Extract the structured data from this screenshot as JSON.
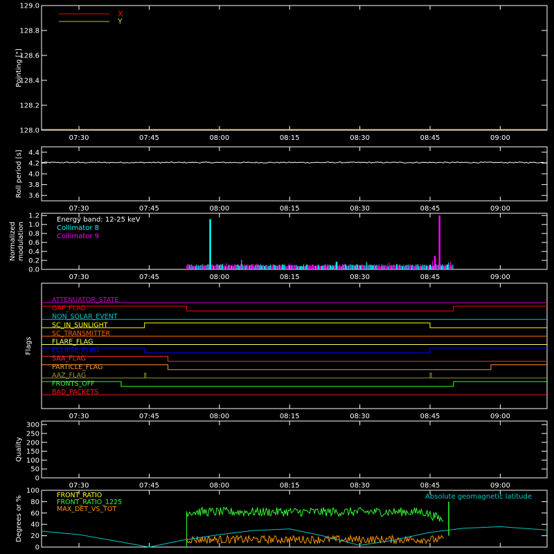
{
  "figure": {
    "background": "#000000",
    "foreground": "#ffffff"
  },
  "time_axis": {
    "start": "07:22",
    "end": "09:10",
    "ticks": [
      "07:30",
      "07:45",
      "08:00",
      "08:15",
      "08:30",
      "08:45",
      "09:00"
    ]
  },
  "chart_data": [
    {
      "type": "line",
      "ylabel": "Pointing [\"]",
      "ylim": [
        128.0,
        129.0
      ],
      "yticks": [
        "128.0",
        "128.2",
        "128.4",
        "128.6",
        "128.8",
        "129.0"
      ],
      "legend_position": "top-left",
      "series": [
        {
          "name": "X",
          "color": "#ff0000",
          "values": []
        },
        {
          "name": "Y",
          "color": "#c8c800",
          "values": []
        }
      ]
    },
    {
      "type": "line",
      "ylabel": "Roll period [s]",
      "ylim": [
        3.5,
        4.5
      ],
      "yticks": [
        "3.6",
        "3.8",
        "4.0",
        "4.2",
        "4.4"
      ],
      "series": [
        {
          "color": "#ffffff",
          "x": [
            "07:22",
            "09:10"
          ],
          "values": [
            4.21,
            4.21
          ]
        }
      ]
    },
    {
      "type": "bar",
      "ylabel": "Normalized modulation",
      "ylim": [
        0.0,
        1.25
      ],
      "yticks": [
        "0.0",
        "0.2",
        "0.4",
        "0.6",
        "0.8",
        "1.0",
        "1.2"
      ],
      "annotation": "Energy band: 12-25 keV",
      "data_range": [
        "07:53",
        "08:50"
      ],
      "baseline": 0.07,
      "series": [
        {
          "name": "Collimator 8",
          "color": "#00ffff",
          "peaks": [
            {
              "x": "07:58",
              "y": 1.12
            },
            {
              "x": "08:25",
              "y": 0.17
            }
          ]
        },
        {
          "name": "Collimator 9",
          "color": "#ff00ff",
          "peaks": [
            {
              "x": "08:47",
              "y": 1.2
            },
            {
              "x": "08:46",
              "y": 0.3
            }
          ]
        }
      ]
    },
    {
      "type": "line",
      "ylabel": "Flags",
      "series": [
        {
          "name": "ATTENUATOR_STATE",
          "color": "#c800c8",
          "steps": [
            {
              "x": "07:22",
              "v": 0
            }
          ]
        },
        {
          "name": "GAP_FLAG",
          "color": "#ff0000",
          "steps": [
            {
              "x": "07:22",
              "v": 1
            },
            {
              "x": "07:53",
              "v": 0
            },
            {
              "x": "08:50",
              "v": 1
            }
          ]
        },
        {
          "name": "NON_SOLAR_EVENT",
          "color": "#00c8c8",
          "steps": [
            {
              "x": "07:22",
              "v": 0
            }
          ]
        },
        {
          "name": "SC_IN_SUNLIGHT",
          "color": "#ffff00",
          "steps": [
            {
              "x": "07:22",
              "v": 0
            },
            {
              "x": "07:44",
              "v": 1
            },
            {
              "x": "08:45",
              "v": 0
            }
          ]
        },
        {
          "name": "SC_TRANSMITTER",
          "color": "#ff6400",
          "steps": [
            {
              "x": "07:22",
              "v": 0
            }
          ]
        },
        {
          "name": "FLARE_FLAG",
          "color": "#ffff64",
          "steps": [
            {
              "x": "07:22",
              "v": 0
            }
          ]
        },
        {
          "name": "ECLIPSE_FLAG",
          "color": "#0000ff",
          "steps": [
            {
              "x": "07:22",
              "v": 1
            },
            {
              "x": "07:44",
              "v": 0
            },
            {
              "x": "08:45",
              "v": 1
            }
          ]
        },
        {
          "name": "SAA_FLAG",
          "color": "#ff3232",
          "steps": [
            {
              "x": "07:22",
              "v": 1
            },
            {
              "x": "07:49",
              "v": 0
            }
          ]
        },
        {
          "name": "PARTICLE_FLAG",
          "color": "#ff9632",
          "steps": [
            {
              "x": "07:22",
              "v": 1
            },
            {
              "x": "07:49",
              "v": 0
            },
            {
              "x": "08:58",
              "v": 1
            }
          ]
        },
        {
          "name": "AAZ_FLAG",
          "color": "#969632",
          "steps": [
            {
              "x": "07:22",
              "v": 0
            }
          ],
          "spikes": [
            "07:44",
            "08:45"
          ]
        },
        {
          "name": "FRONTS_OFF",
          "color": "#32ff32",
          "steps": [
            {
              "x": "07:22",
              "v": 1
            },
            {
              "x": "07:39",
              "v": 0
            },
            {
              "x": "08:50",
              "v": 1
            }
          ]
        },
        {
          "name": "BAD_PACKETS",
          "color": "#ff1414",
          "steps": [
            {
              "x": "07:22",
              "v": 0
            }
          ]
        }
      ]
    },
    {
      "type": "line",
      "ylabel": "Quality",
      "ylim": [
        0,
        320
      ],
      "yticks": [
        "0",
        "50",
        "100",
        "150",
        "200",
        "250",
        "300"
      ],
      "series": []
    },
    {
      "type": "line",
      "ylabel": "Degrees or %",
      "ylim": [
        0,
        100
      ],
      "yticks": [
        "0",
        "20",
        "40",
        "60",
        "80",
        "100"
      ],
      "right_annotation": "Absolute geomagnetic latitude",
      "series": [
        {
          "name": "FRONT_RATIO",
          "color": "#ffff00",
          "values": []
        },
        {
          "name": "FRONT_RATIO_1225",
          "color": "#32ff32",
          "data_range": [
            "07:53",
            "08:48"
          ],
          "level": 62,
          "spike": {
            "x": "08:49",
            "y": 80
          }
        },
        {
          "name": "MAX_DET_VS_TOT",
          "color": "#ff9600",
          "data_range": [
            "07:53",
            "08:48"
          ],
          "level": 12
        },
        {
          "name": "Absolute geomagnetic latitude",
          "color": "#00c8c8",
          "legend": false,
          "x": [
            "07:22",
            "07:30",
            "07:37",
            "07:45",
            "07:52",
            "08:00",
            "08:07",
            "08:15",
            "08:22",
            "08:30",
            "08:37",
            "08:45",
            "08:52",
            "09:00",
            "09:10"
          ],
          "values": [
            28,
            22,
            12,
            0,
            12,
            22,
            29,
            32,
            20,
            3,
            12,
            26,
            33,
            36,
            30
          ]
        }
      ]
    }
  ]
}
